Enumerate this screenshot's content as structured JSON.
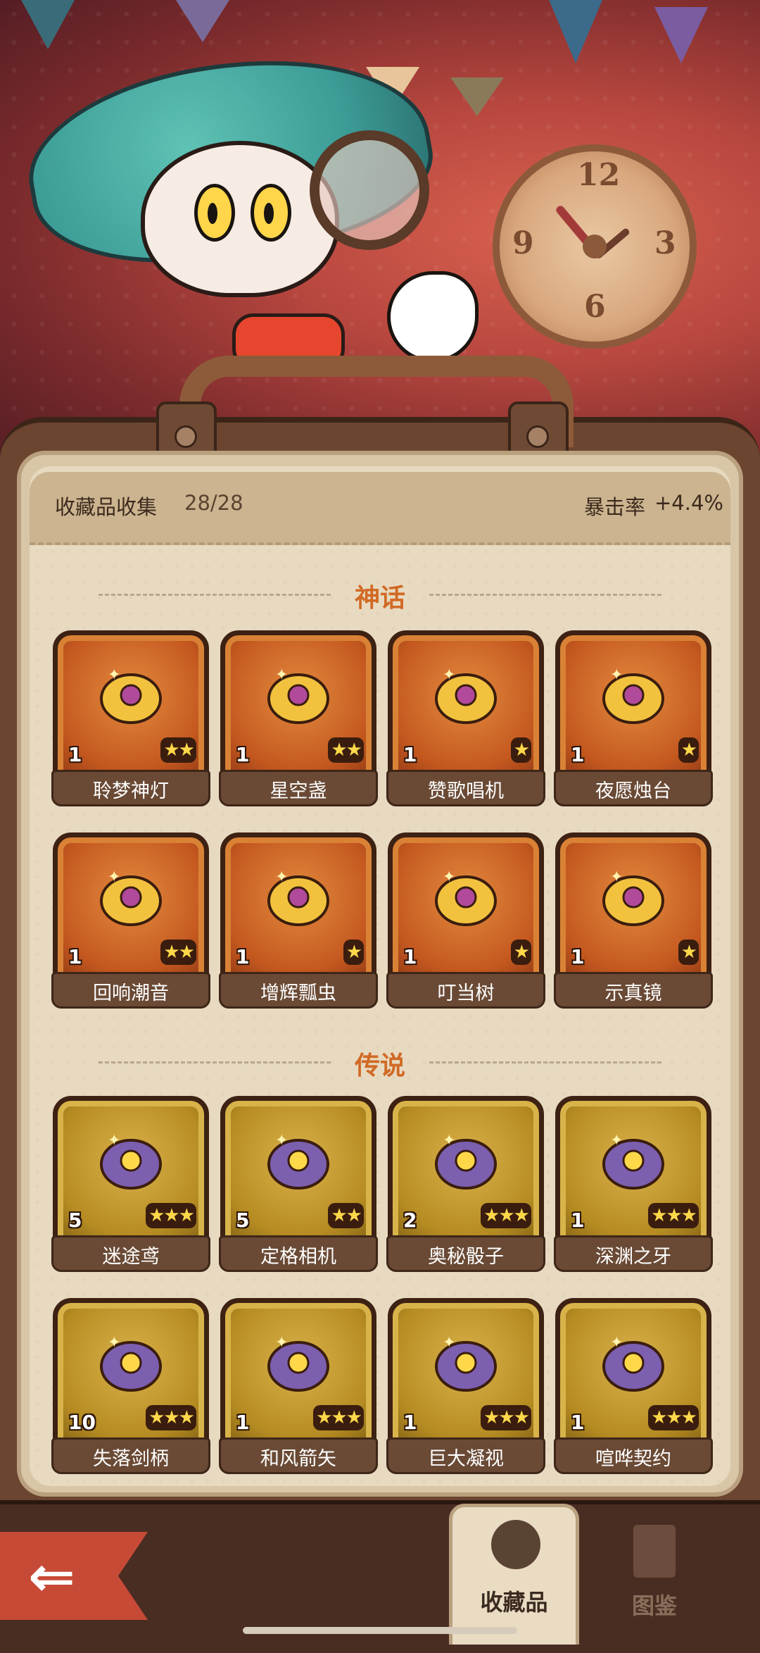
{
  "header": {
    "collection_label": "收藏品收集",
    "collection_count": "28/28",
    "bonus_label": "暴击率",
    "bonus_value": "+4.4%"
  },
  "sections": {
    "myth_title": "神话",
    "legend_title": "传说"
  },
  "myth_items": [
    {
      "name": "聆梦神灯",
      "count": "1",
      "stars": "★★",
      "icon": "magic-lamp-icon"
    },
    {
      "name": "星空盏",
      "count": "1",
      "stars": "★★",
      "icon": "star-cup-icon"
    },
    {
      "name": "赞歌唱机",
      "count": "1",
      "stars": "★",
      "icon": "gramophone-icon"
    },
    {
      "name": "夜愿烛台",
      "count": "1",
      "stars": "★",
      "icon": "candlestick-icon"
    },
    {
      "name": "回响潮音",
      "count": "1",
      "stars": "★★",
      "icon": "seashell-icon"
    },
    {
      "name": "增辉瓢虫",
      "count": "1",
      "stars": "★",
      "icon": "ladybug-icon"
    },
    {
      "name": "叮当树",
      "count": "1",
      "stars": "★",
      "icon": "coin-tree-icon"
    },
    {
      "name": "示真镜",
      "count": "1",
      "stars": "★",
      "icon": "mirror-icon"
    }
  ],
  "legend_items": [
    {
      "name": "迷途鸢",
      "count": "5",
      "stars": "★★★",
      "icon": "penguin-bird-icon"
    },
    {
      "name": "定格相机",
      "count": "5",
      "stars": "★★",
      "icon": "camera-icon"
    },
    {
      "name": "奥秘骰子",
      "count": "2",
      "stars": "★★★",
      "icon": "dice-icon"
    },
    {
      "name": "深渊之牙",
      "count": "1",
      "stars": "★★★",
      "icon": "fang-dagger-icon"
    },
    {
      "name": "失落剑柄",
      "count": "10",
      "stars": "★★★",
      "icon": "sword-hilt-icon"
    },
    {
      "name": "和风箭矢",
      "count": "1",
      "stars": "★★★",
      "icon": "pinwheel-arrow-icon"
    },
    {
      "name": "巨大凝视",
      "count": "1",
      "stars": "★★★",
      "icon": "eye-glove-icon"
    },
    {
      "name": "喧哗契约",
      "count": "1",
      "stars": "★★★",
      "icon": "scroll-contract-icon"
    }
  ],
  "nav": {
    "back_icon": "back-arrow-icon",
    "collection_tab": "收藏品",
    "codex_tab": "图鉴"
  },
  "colors": {
    "myth_card": "#c4581f",
    "legend_card": "#b68c22",
    "section_title": "#d16a25",
    "back_ribbon": "#c74a36"
  }
}
